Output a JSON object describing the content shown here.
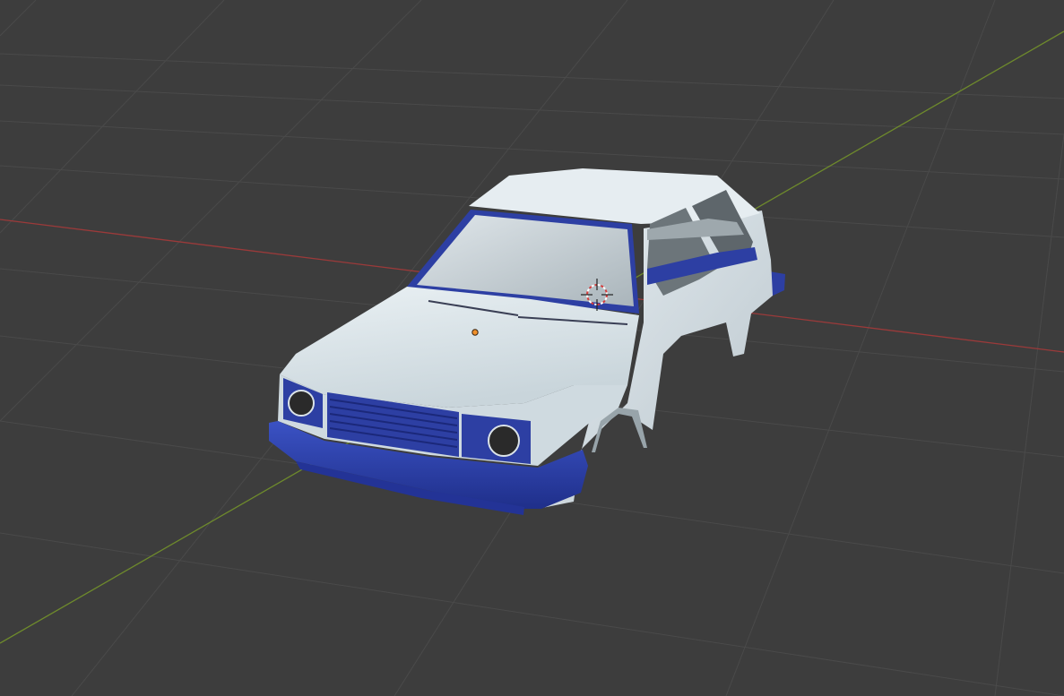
{
  "app": "3D viewport",
  "viewport": {
    "background": "#3d3d3d",
    "grid_line_color": "#4b4b4b",
    "x_axis_color": "#9b3a3a",
    "y_axis_color": "#6e8a2c"
  },
  "scene": {
    "object": "car-body",
    "body_color": "#d6e0e6",
    "trim_color": "#2d3fa3",
    "glass_color": "#c3cdd2",
    "origin_marker_color": "#f0902a",
    "cursor_colors": [
      "#d63a3a",
      "#ffffff"
    ]
  },
  "icons": [
    "3d-cursor-icon",
    "object-origin-icon"
  ]
}
